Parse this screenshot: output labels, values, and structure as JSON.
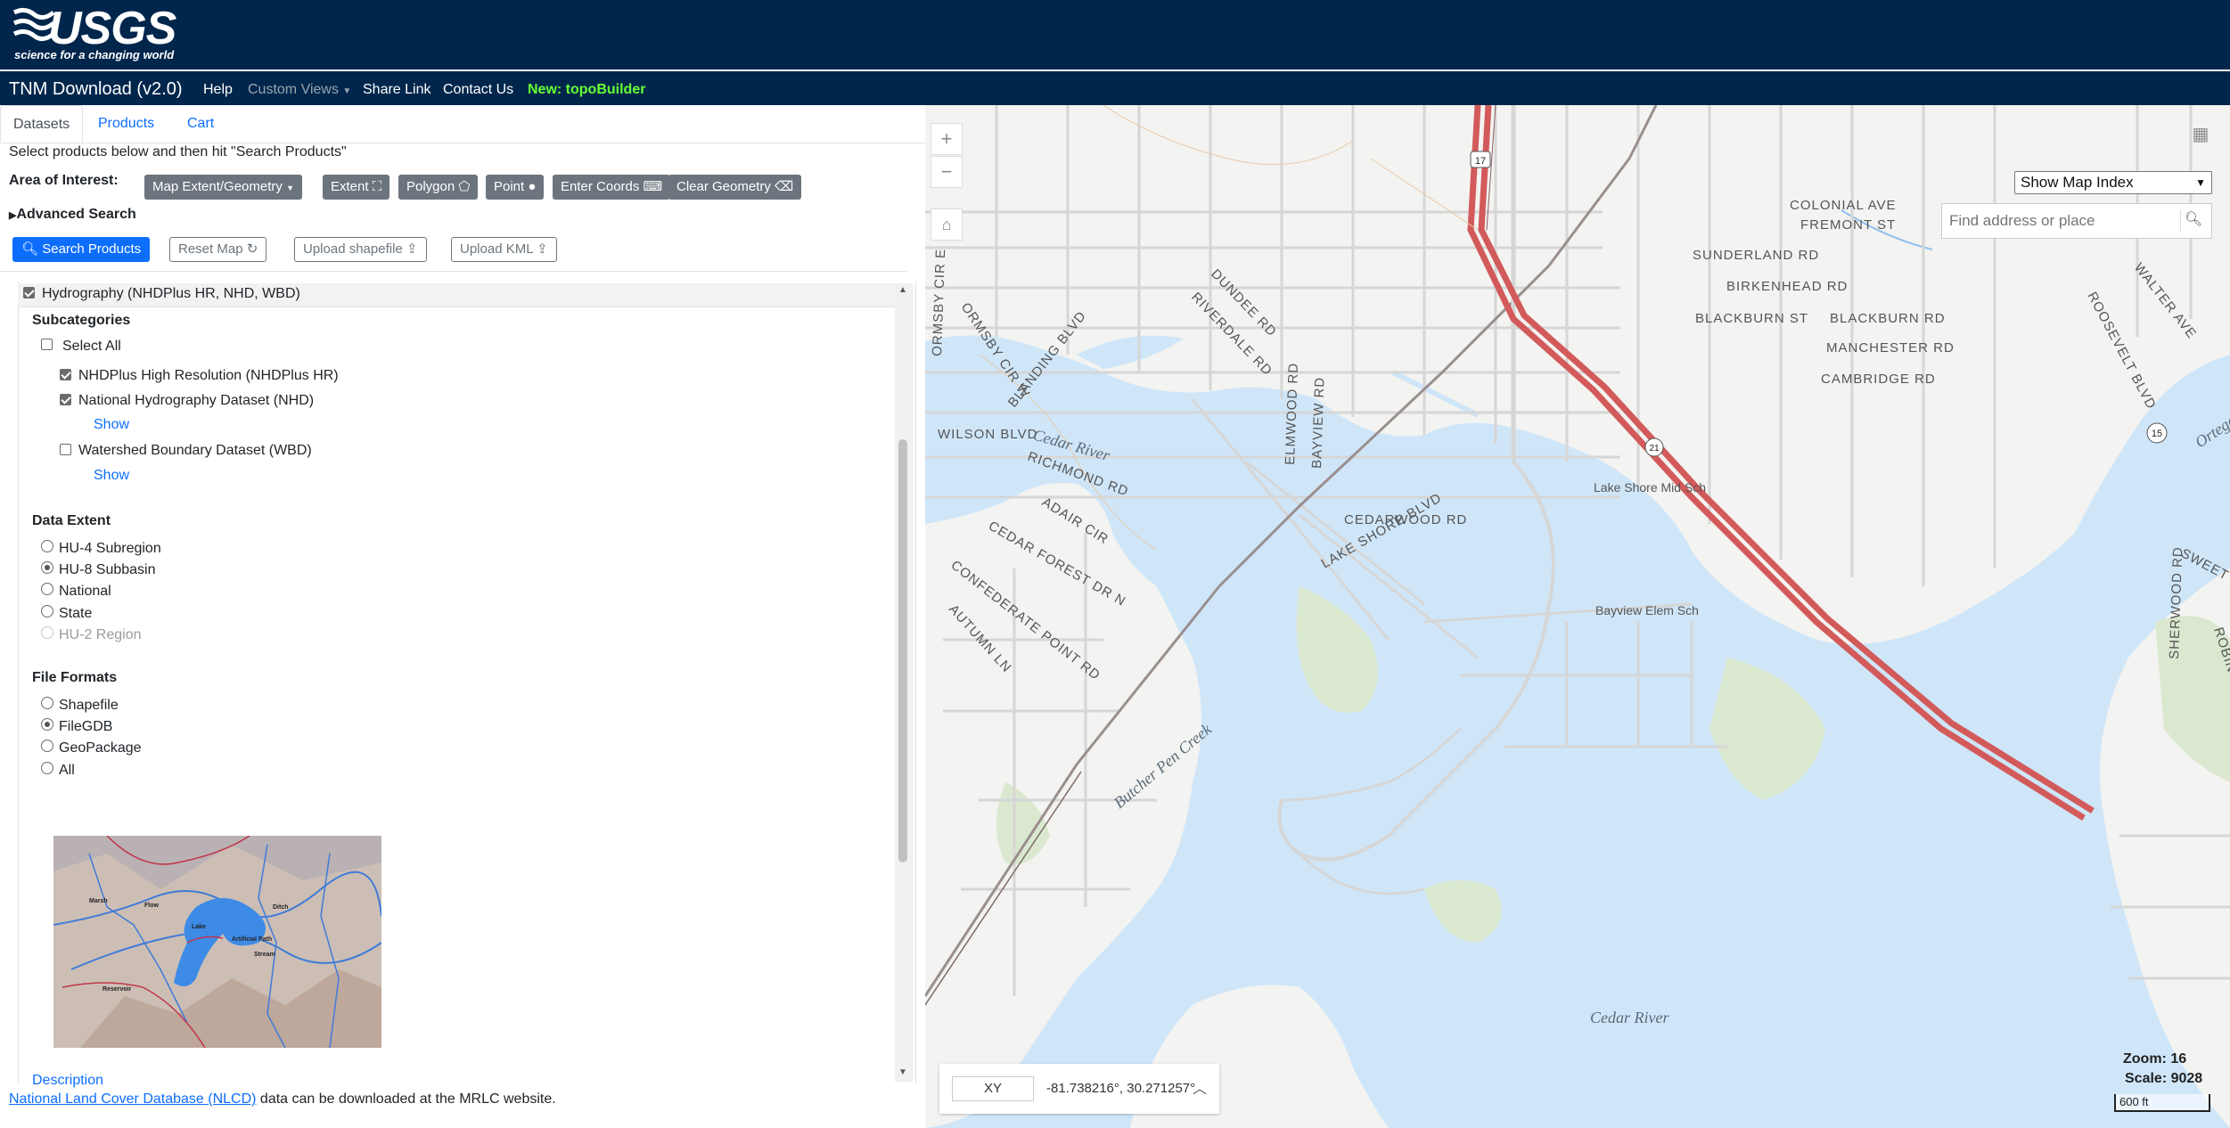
{
  "header": {
    "logo_text": "USGS",
    "logo_tagline": "science for a changing world"
  },
  "navbar": {
    "brand": "TNM Download (v2.0)",
    "help": "Help",
    "custom_views": "Custom Views",
    "share_link": "Share Link",
    "contact_us": "Contact Us",
    "new_feature": "New: topoBuilder"
  },
  "tabs": [
    {
      "label": "Datasets"
    },
    {
      "label": "Products"
    },
    {
      "label": "Cart"
    }
  ],
  "instructions": "Select products below and then hit \"Search Products\"",
  "aoi": {
    "label": "Area of Interest:",
    "map_extent": "Map Extent/Geometry",
    "extent": "Extent",
    "polygon": "Polygon",
    "point": "Point",
    "enter_coords": "Enter Coords",
    "clear_geometry": "Clear Geometry"
  },
  "advanced_search": "Advanced Search",
  "actions": {
    "search_products": "Search Products",
    "reset_map": "Reset Map",
    "upload_shapefile": "Upload shapefile",
    "upload_kml": "Upload KML"
  },
  "dataset": {
    "title": "Hydrography (NHDPlus HR, NHD, WBD)",
    "checked": true,
    "subcategories_label": "Subcategories",
    "select_all": "Select All",
    "items": [
      {
        "label": "NHDPlus High Resolution (NHDPlus HR)",
        "checked": true
      },
      {
        "label": "National Hydrography Dataset (NHD)",
        "checked": true,
        "show": "Show"
      },
      {
        "label": "Watershed Boundary Dataset (WBD)",
        "checked": false,
        "show": "Show"
      }
    ]
  },
  "data_extent": {
    "label": "Data Extent",
    "options": [
      {
        "label": "HU-4 Subregion",
        "checked": false,
        "disabled": false
      },
      {
        "label": "HU-8 Subbasin",
        "checked": true,
        "disabled": false
      },
      {
        "label": "National",
        "checked": false,
        "disabled": false
      },
      {
        "label": "State",
        "checked": false,
        "disabled": false
      },
      {
        "label": "HU-2 Region",
        "checked": false,
        "disabled": true
      }
    ]
  },
  "file_formats": {
    "label": "File Formats",
    "options": [
      {
        "label": "Shapefile",
        "checked": false
      },
      {
        "label": "FileGDB",
        "checked": true
      },
      {
        "label": "GeoPackage",
        "checked": false
      },
      {
        "label": "All",
        "checked": false
      }
    ]
  },
  "thumbnail": {
    "labels": [
      "Marsh",
      "Flow",
      "Lake",
      "Artificial Path",
      "Stream",
      "Ditch",
      "Reservoir"
    ]
  },
  "description_link": "Description",
  "footer": {
    "nlcd_link": "National Land Cover Database (NLCD)",
    "nlcd_text": " data can be downloaded at the MRLC website."
  },
  "map": {
    "map_index_select": "Show Map Index",
    "search_placeholder": "Find address or place",
    "coord_mode": "XY",
    "coord_value": "-81.738216°, 30.271257°",
    "zoom": "Zoom: 16",
    "scale": "Scale: 9028",
    "scalebar": "600 ft",
    "street_labels": [
      "COLONIAL AVE",
      "FREMONT ST",
      "SUNDERLAND RD",
      "BIRKENHEAD RD",
      "BLACKBURN ST",
      "BLACKBURN RD",
      "MANCHESTER RD",
      "CAMBRIDGE RD",
      "DUNDEE RD",
      "RIVERDALE RD",
      "ROOSEVELT BLVD",
      "WALTER AVE",
      "ORMSBY CIR W",
      "ORMSBY CIR E",
      "BLANDING BLVD",
      "WILSON BLVD",
      "RICHMOND RD",
      "ADAIR CIR",
      "CEDAR FOREST DR N",
      "CONFEDERATE POINT RD",
      "AUTUMN LN",
      "ELMWOOD RD",
      "BAYVIEW RD",
      "CEDARWOOD RD",
      "LAKE SHORE BLVD",
      "SWEET GUM LN",
      "SHERWOOD RD",
      "ROBIN HOOD"
    ],
    "water_labels": [
      "Cedar River",
      "Ortega River",
      "Butcher Pen Creek",
      "Cedar River"
    ],
    "poi_labels": [
      "Lake Shore Mid Sch",
      "Bayview Elem Sch"
    ],
    "route_shields": [
      "17",
      "15",
      "21"
    ],
    "colors": {
      "water": "#cfe6f9",
      "land": "#f3f3f1",
      "highway": "#d35a5a",
      "park": "#dbe8d0"
    }
  }
}
